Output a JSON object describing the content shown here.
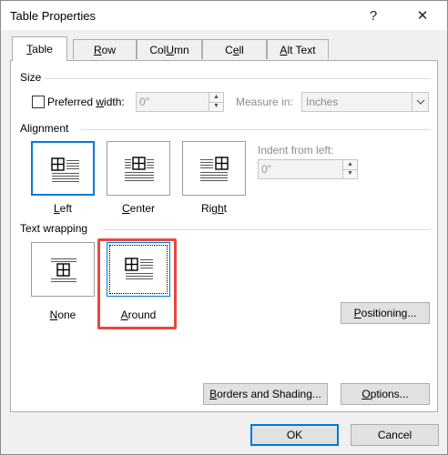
{
  "window": {
    "title": "Table Properties",
    "help_label": "?",
    "close_label": "✕"
  },
  "tabs": [
    {
      "label": "Table",
      "accel": "T",
      "rest": "able",
      "active": true
    },
    {
      "label": "Row",
      "accel": "R",
      "rest": "ow",
      "active": false
    },
    {
      "label": "Column",
      "accel": "U",
      "pre": "Col",
      "rest": "mn",
      "active": false
    },
    {
      "label": "Cell",
      "pre": "C",
      "accel": "e",
      "rest": "ll",
      "active": false
    },
    {
      "label": "Alt Text",
      "accel": "A",
      "rest": "lt Text",
      "active": false
    }
  ],
  "size": {
    "section_label": "Size",
    "preferred_width_pre": "Preferred ",
    "preferred_width_accel": "w",
    "preferred_width_rest": "idth:",
    "preferred_width_checked": false,
    "width_value": "0\"",
    "measure_in_label": "Measure in:",
    "measure_in_value": "Inches"
  },
  "alignment": {
    "section_label": "Alignment",
    "options": [
      {
        "label": "Left",
        "accel": "L",
        "rest": "eft",
        "selected": true
      },
      {
        "label": "Center",
        "accel": "C",
        "rest": "enter",
        "selected": false
      },
      {
        "label": "Right",
        "pre": "Rig",
        "accel": "h",
        "rest": "t",
        "selected": false
      }
    ],
    "indent_label": "Indent from left:",
    "indent_value": "0\""
  },
  "text_wrapping": {
    "section_label": "Text wrapping",
    "options": [
      {
        "label": "None",
        "accel": "N",
        "rest": "one",
        "selected": false
      },
      {
        "label": "Around",
        "accel": "A",
        "rest": "round",
        "selected": true
      }
    ],
    "positioning_button": {
      "label": "Positioning...",
      "accel": "P",
      "rest": "ositioning..."
    }
  },
  "buttons": {
    "borders_shading": {
      "label": "Borders and Shading...",
      "accel": "B",
      "rest": "orders and Shading..."
    },
    "options": {
      "label": "Options...",
      "accel": "O",
      "rest": "ptions..."
    },
    "ok": "OK",
    "cancel": "Cancel"
  },
  "colors": {
    "accent": "#0078d7",
    "highlight": "#e8473e"
  }
}
